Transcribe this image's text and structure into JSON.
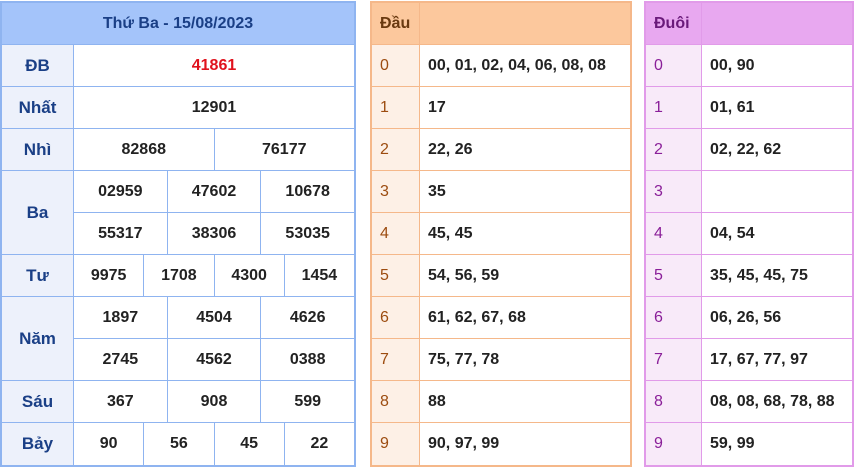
{
  "results": {
    "title": "Thứ Ba - 15/08/2023",
    "prizes": [
      {
        "label": "ĐB",
        "rows": [
          [
            "41861"
          ]
        ],
        "highlight": true
      },
      {
        "label": "Nhất",
        "rows": [
          [
            "12901"
          ]
        ]
      },
      {
        "label": "Nhì",
        "rows": [
          [
            "82868",
            "76177"
          ]
        ]
      },
      {
        "label": "Ba",
        "rows": [
          [
            "02959",
            "47602",
            "10678"
          ],
          [
            "55317",
            "38306",
            "53035"
          ]
        ]
      },
      {
        "label": "Tư",
        "rows": [
          [
            "9975",
            "1708",
            "4300",
            "1454"
          ]
        ]
      },
      {
        "label": "Năm",
        "rows": [
          [
            "1897",
            "4504",
            "4626"
          ],
          [
            "2745",
            "4562",
            "0388"
          ]
        ]
      },
      {
        "label": "Sáu",
        "rows": [
          [
            "367",
            "908",
            "599"
          ]
        ]
      },
      {
        "label": "Bảy",
        "rows": [
          [
            "90",
            "56",
            "45",
            "22"
          ]
        ]
      }
    ]
  },
  "dau": {
    "header": "Đầu",
    "rows": [
      {
        "key": "0",
        "value": "00, 01, 02, 04, 06, 08, 08"
      },
      {
        "key": "1",
        "value": "17"
      },
      {
        "key": "2",
        "value": "22, 26"
      },
      {
        "key": "3",
        "value": "35"
      },
      {
        "key": "4",
        "value": "45, 45"
      },
      {
        "key": "5",
        "value": "54, 56, 59"
      },
      {
        "key": "6",
        "value": "61, 62, 67, 68"
      },
      {
        "key": "7",
        "value": "75, 77, 78"
      },
      {
        "key": "8",
        "value": "88"
      },
      {
        "key": "9",
        "value": "90, 97, 99"
      }
    ]
  },
  "duoi": {
    "header": "Đuôi",
    "rows": [
      {
        "key": "0",
        "value": "00, 90"
      },
      {
        "key": "1",
        "value": "01, 61"
      },
      {
        "key": "2",
        "value": "02, 22, 62"
      },
      {
        "key": "3",
        "value": ""
      },
      {
        "key": "4",
        "value": "04, 54"
      },
      {
        "key": "5",
        "value": "35, 45, 45, 75"
      },
      {
        "key": "6",
        "value": "06, 26, 56"
      },
      {
        "key": "7",
        "value": "17, 67, 77, 97"
      },
      {
        "key": "8",
        "value": "08, 08, 68, 78, 88"
      },
      {
        "key": "9",
        "value": "59, 99"
      }
    ]
  }
}
